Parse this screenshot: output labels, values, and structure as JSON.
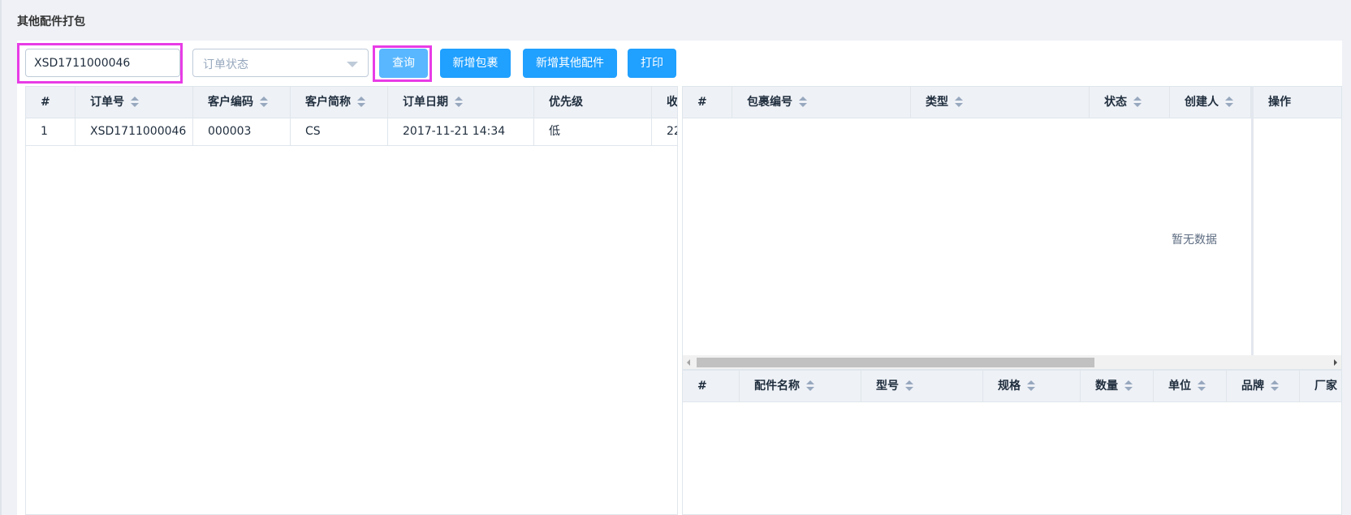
{
  "page": {
    "title": "其他配件打包"
  },
  "toolbar": {
    "search_value": "XSD1711000046",
    "status_placeholder": "订单状态",
    "query_label": "查询",
    "add_package_label": "新增包裹",
    "add_other_label": "新增其他配件",
    "print_label": "打印"
  },
  "orders_table": {
    "columns": [
      "#",
      "订单号",
      "客户编码",
      "客户简称",
      "订单日期",
      "优先级",
      "收"
    ],
    "rows": [
      [
        "1",
        "XSD1711000046",
        "000003",
        "CS",
        "2017-11-21 14:34",
        "低",
        "22"
      ]
    ]
  },
  "packages_table": {
    "columns": [
      "#",
      "包裹编号",
      "类型",
      "状态",
      "创建人",
      "操作"
    ],
    "empty_text": "暂无数据"
  },
  "parts_table": {
    "columns": [
      "#",
      "配件名称",
      "型号",
      "规格",
      "数量",
      "单位",
      "品牌",
      "厂家"
    ]
  },
  "colors": {
    "primary": "#20a0ff",
    "primary_light": "#58b7ff",
    "highlight": "#e83ce6",
    "header_bg": "#eef1f6"
  }
}
